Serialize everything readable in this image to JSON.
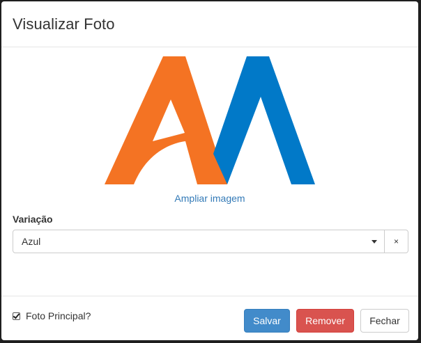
{
  "modal": {
    "title": "Visualizar Foto"
  },
  "image": {
    "logo_colors": {
      "orange": "#F47323",
      "blue": "#0179C8"
    },
    "zoom_link": "Ampliar imagem"
  },
  "variation": {
    "label": "Variação",
    "selected": "Azul",
    "clear_label": "×"
  },
  "main_photo": {
    "label": "Foto Principal?",
    "checked": true
  },
  "footer": {
    "save_label": "Salvar",
    "remove_label": "Remover",
    "close_label": "Fechar"
  }
}
